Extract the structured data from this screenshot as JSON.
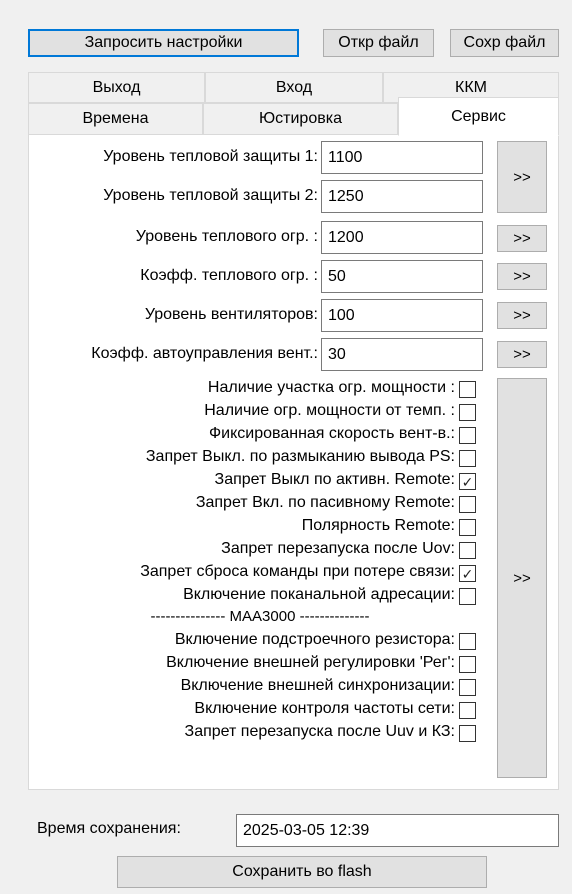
{
  "toolbar": {
    "request_settings": "Запросить настройки",
    "open_file": "Откр файл",
    "save_file": "Сохр файл"
  },
  "tabs": {
    "row1": [
      "Выход",
      "Вход",
      "ККМ"
    ],
    "row2": [
      "Времена",
      "Юстировка",
      "Сервис"
    ],
    "active": "Сервис"
  },
  "fields": [
    {
      "label": "Уровень тепловой защиты 1:",
      "value": "1100"
    },
    {
      "label": "Уровень тепловой защиты 2:",
      "value": "1250"
    },
    {
      "label": "Уровень теплового огр. :",
      "value": "1200"
    },
    {
      "label": "Коэфф. теплового огр. :",
      "value": "50"
    },
    {
      "label": "Уровень вентиляторов:",
      "value": "100"
    },
    {
      "label": "Коэфф. автоуправления вент.:",
      "value": "30"
    }
  ],
  "arrow_label": ">>",
  "checkboxes": [
    {
      "label": "Наличие участка огр. мощности :",
      "checked": false
    },
    {
      "label": "Наличие огр. мощности от темп. :",
      "checked": false
    },
    {
      "label": "Фиксированная скорость вент-в.:",
      "checked": false
    },
    {
      "label": "Запрет Выкл. по размыканию вывода PS:",
      "checked": false
    },
    {
      "label": "Запрет Выкл по активн. Remote:",
      "checked": true
    },
    {
      "label": "Запрет Вкл. по пасивному Remote:",
      "checked": false
    },
    {
      "label": "Полярность Remote:",
      "checked": false
    },
    {
      "label": "Запрет перезапуска после Uov:",
      "checked": false
    },
    {
      "label": "Запрет сброса команды при потере связи:",
      "checked": true
    },
    {
      "label": "Включение поканальной адресации:",
      "checked": false
    }
  ],
  "separator": "--------------- МАА3000 --------------",
  "checkboxes2": [
    {
      "label": "Включение подстроечного резистора:",
      "checked": false
    },
    {
      "label": "Включение внешней регулировки 'Рег':",
      "checked": false
    },
    {
      "label": "Включение внешней синхронизации:",
      "checked": false
    },
    {
      "label": "Включение контроля частоты сети:",
      "checked": false
    },
    {
      "label": "Запрет перезапуска после Uuv и КЗ:",
      "checked": false
    }
  ],
  "save_time": {
    "label": "Время сохранения:",
    "value": "2025-03-05 12:39"
  },
  "save_flash": "Сохранить во flash",
  "check_mark": "✓"
}
